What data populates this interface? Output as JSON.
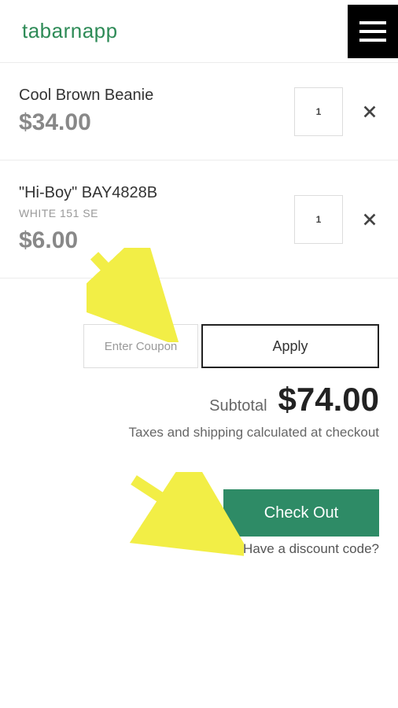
{
  "header": {
    "brand": "tabarnapp"
  },
  "items": [
    {
      "name": "Cool Brown Beanie",
      "variant": "",
      "price": "$34.00",
      "qty": "1"
    },
    {
      "name": "\"Hi-Boy\" BAY4828B",
      "variant": "WHITE 151 SE",
      "price": "$6.00",
      "qty": "1"
    }
  ],
  "coupon": {
    "placeholder": "Enter Coupon",
    "apply": "Apply"
  },
  "subtotal": {
    "label": "Subtotal",
    "amount": "$74.00"
  },
  "tax_note": "Taxes and shipping calculated at checkout",
  "checkout": "Check Out",
  "discount_link": "Have a discount code?"
}
